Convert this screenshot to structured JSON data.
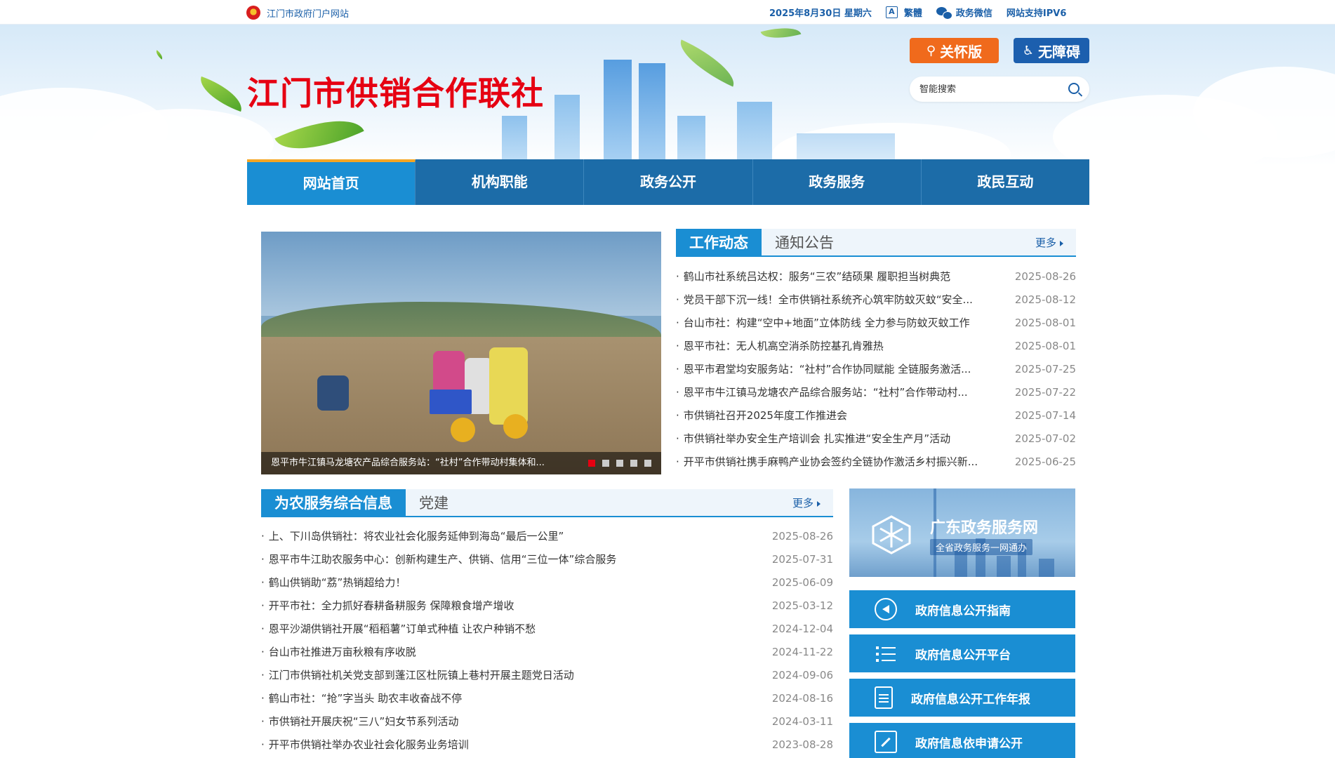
{
  "topbar": {
    "portal_label": "江门市政府门户网站",
    "date": "2025年8月30日 星期六",
    "traditional_label": "繁體",
    "wechat_label": "政务微信",
    "ipv6_label": "网站支持IPV6"
  },
  "header": {
    "site_title": "江门市供销合作联社",
    "care_button": "关怀版",
    "access_button": "无障碍",
    "search_placeholder": "智能搜索"
  },
  "nav": {
    "tabs": [
      {
        "label": "网站首页"
      },
      {
        "label": "机构职能"
      },
      {
        "label": "政务公开"
      },
      {
        "label": "政务服务"
      },
      {
        "label": "政民互动"
      }
    ]
  },
  "slider": {
    "caption": "恩平市牛江镇马龙塘农产品综合服务站：“社村”合作带动村集体和..."
  },
  "work_news": {
    "tab_active": "工作动态",
    "tab_inactive": "通知公告",
    "more": "更多",
    "items": [
      {
        "title": "鹤山市社系统吕达权：服务“三农”结硕果 履职担当树典范",
        "date": "2025-08-26"
      },
      {
        "title": "党员干部下沉一线！全市供销社系统齐心筑牢防蚊灭蚊“安全...",
        "date": "2025-08-12"
      },
      {
        "title": "台山市社：构建“空中+地面”立体防线 全力参与防蚊灭蚊工作",
        "date": "2025-08-01"
      },
      {
        "title": "恩平市社：无人机高空消杀防控基孔肯雅热",
        "date": "2025-08-01"
      },
      {
        "title": "恩平市君堂均安服务站：“社村”合作协同赋能 全链服务激活...",
        "date": "2025-07-25"
      },
      {
        "title": "恩平市牛江镇马龙塘农产品综合服务站：“社村”合作带动村...",
        "date": "2025-07-22"
      },
      {
        "title": "市供销社召开2025年度工作推进会",
        "date": "2025-07-14"
      },
      {
        "title": "市供销社举办安全生产培训会 扎实推进“安全生产月”活动",
        "date": "2025-07-02"
      },
      {
        "title": "开平市供销社携手麻鸭产业协会签约全链协作激活乡村振兴新...",
        "date": "2025-06-25"
      }
    ]
  },
  "farm_info": {
    "tab_active": "为农服务综合信息",
    "tab_inactive": "党建",
    "more": "更多",
    "items": [
      {
        "title": "上、下川岛供销社：将农业社会化服务延伸到海岛“最后一公里”",
        "date": "2025-08-26"
      },
      {
        "title": "恩平市牛江助农服务中心：创新构建生产、供销、信用“三位一体”综合服务",
        "date": "2025-07-31"
      },
      {
        "title": "鹤山供销助“荔”热销超给力！",
        "date": "2025-06-09"
      },
      {
        "title": "开平市社：全力抓好春耕备耕服务 保障粮食增产增收",
        "date": "2025-03-12"
      },
      {
        "title": "恩平沙湖供销社开展“稻稻薯”订单式种植 让农户种销不愁",
        "date": "2024-12-04"
      },
      {
        "title": "台山市社推进万亩秋粮有序收脱",
        "date": "2024-11-22"
      },
      {
        "title": "江门市供销社机关党支部到蓬江区杜阮镇上巷村开展主题党日活动",
        "date": "2024-09-06"
      },
      {
        "title": "鹤山市社：“抢”字当头 助农丰收奋战不停",
        "date": "2024-08-16"
      },
      {
        "title": "市供销社开展庆祝“三八”妇女节系列活动",
        "date": "2024-03-11"
      },
      {
        "title": "开平市供销社举办农业社会化服务业务培训",
        "date": "2023-08-28"
      }
    ]
  },
  "services": {
    "banner_name": "广东政务服务网",
    "banner_sub": "全省政务服务一网通办",
    "items": [
      {
        "label": "政府信息公开指南",
        "icon": "compass-icon"
      },
      {
        "label": "政府信息公开平台",
        "icon": "list-icon"
      },
      {
        "label": "政府信息公开工作年报",
        "icon": "document-icon"
      },
      {
        "label": "政府信息依申请公开",
        "icon": "edit-icon"
      }
    ]
  }
}
